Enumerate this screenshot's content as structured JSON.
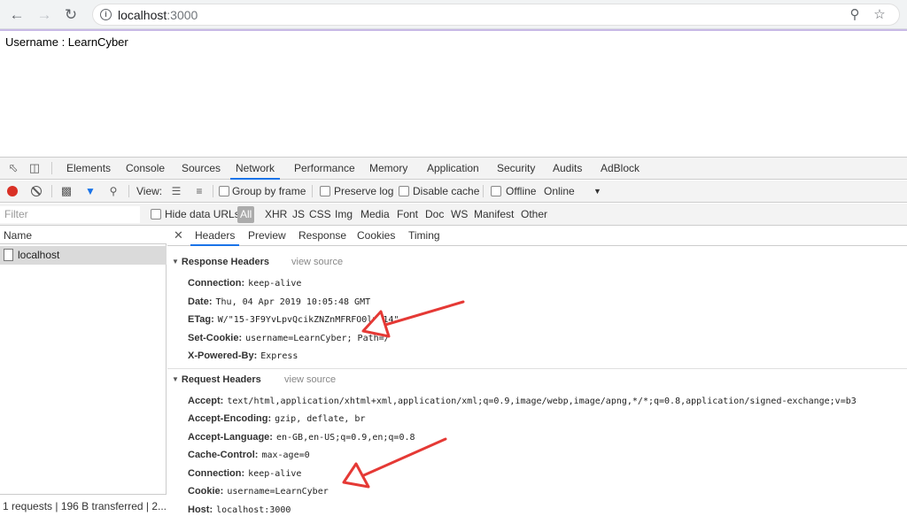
{
  "browser": {
    "url_host": "localhost",
    "url_port": ":3000"
  },
  "page": {
    "text": "Username : LearnCyber"
  },
  "devtools": {
    "tabs": [
      "Elements",
      "Console",
      "Sources",
      "Network",
      "Performance",
      "Memory",
      "Application",
      "Security",
      "Audits",
      "AdBlock"
    ],
    "active_tab": "Network",
    "toolbar": {
      "view_label": "View:",
      "group_by_frame": "Group by frame",
      "preserve_log": "Preserve log",
      "disable_cache": "Disable cache",
      "offline": "Offline",
      "throttle": "Online"
    },
    "filter": {
      "placeholder": "Filter",
      "hide_data_urls": "Hide data URLs",
      "types": [
        "All",
        "XHR",
        "JS",
        "CSS",
        "Img",
        "Media",
        "Font",
        "Doc",
        "WS",
        "Manifest",
        "Other"
      ],
      "active_type": "All"
    },
    "requests": {
      "column": "Name",
      "items": [
        "localhost"
      ],
      "status": "1 requests | 196 B transferred | 2..."
    },
    "detail": {
      "tabs": [
        "Headers",
        "Preview",
        "Response",
        "Cookies",
        "Timing"
      ],
      "active_tab": "Headers",
      "response_headers": {
        "title": "Response Headers",
        "view_source": "view source",
        "items": [
          {
            "k": "Connection:",
            "v": "keep-alive"
          },
          {
            "k": "Date:",
            "v": "Thu, 04 Apr 2019 10:05:48 GMT"
          },
          {
            "k": "ETag:",
            "v": "W/\"15-3F9YvLpvQcikZNZnMFRFO0lvW14\""
          },
          {
            "k": "Set-Cookie:",
            "v": "username=LearnCyber; Path=/"
          },
          {
            "k": "X-Powered-By:",
            "v": "Express"
          }
        ]
      },
      "request_headers": {
        "title": "Request Headers",
        "view_source": "view source",
        "items": [
          {
            "k": "Accept:",
            "v": "text/html,application/xhtml+xml,application/xml;q=0.9,image/webp,image/apng,*/*;q=0.8,application/signed-exchange;v=b3"
          },
          {
            "k": "Accept-Encoding:",
            "v": "gzip, deflate, br"
          },
          {
            "k": "Accept-Language:",
            "v": "en-GB,en-US;q=0.9,en;q=0.8"
          },
          {
            "k": "Cache-Control:",
            "v": "max-age=0"
          },
          {
            "k": "Connection:",
            "v": "keep-alive"
          },
          {
            "k": "Cookie:",
            "v": "username=LearnCyber"
          },
          {
            "k": "Host:",
            "v": "localhost:3000"
          }
        ]
      }
    }
  },
  "annotation_color": "#e53935"
}
